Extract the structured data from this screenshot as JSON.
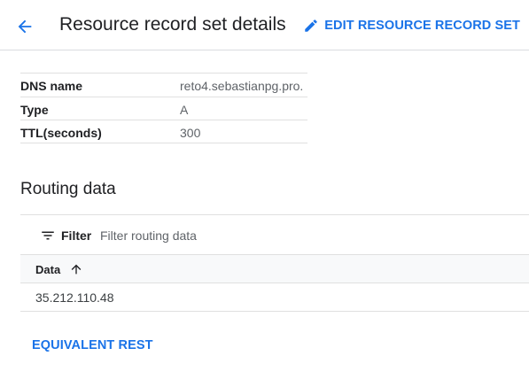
{
  "header": {
    "title": "Resource record set details",
    "edit_label": "EDIT RESOURCE RECORD SET"
  },
  "details": [
    {
      "key": "DNS name",
      "value": "reto4.sebastianpg.pro."
    },
    {
      "key": "Type",
      "value": "A"
    },
    {
      "key": "TTL(seconds)",
      "value": "300"
    }
  ],
  "routing": {
    "title": "Routing data",
    "filter_label": "Filter",
    "filter_placeholder": "Filter routing data",
    "column_header": "Data",
    "sort_direction": "ascending",
    "rows": [
      {
        "data": "35.212.110.48"
      }
    ]
  },
  "footer": {
    "rest_label": "EQUIVALENT REST"
  },
  "colors": {
    "accent": "#1a73e8",
    "text": "#202124",
    "muted": "#5f6368",
    "divider": "#e0e0e0"
  }
}
